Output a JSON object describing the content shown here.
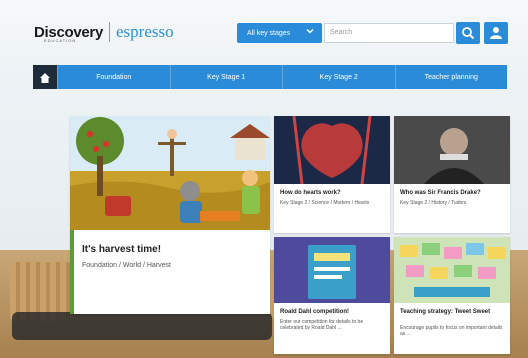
{
  "brand": {
    "name": "Discovery",
    "subtitle": "EDUCATION",
    "product": "espresso"
  },
  "header": {
    "stage_label": "All key stages",
    "search_placeholder": "Search"
  },
  "nav": {
    "items": [
      "Foundation",
      "Key Stage 1",
      "Key Stage 2",
      "Teacher planning"
    ]
  },
  "feature": {
    "title": "It's harvest time!",
    "meta": "Foundation / World / Harvest"
  },
  "cards": [
    {
      "title": "How do hearts work?",
      "meta": "Key Stage 2 / Science / Modern / Hearts"
    },
    {
      "title": "Who was Sir Francis Drake?",
      "meta": "Key Stage 2 / History / Tudors"
    },
    {
      "title": "Roald Dahl competition!",
      "meta": "Enter our competition for details to be celebrated by Roald Dahl ..."
    },
    {
      "title": "Teaching strategy: Tweet Sweet",
      "meta": "Encourage pupils to focus on important details as ..."
    }
  ],
  "colors": {
    "accent": "#2a8bd9",
    "nav_home": "#1e2b38",
    "product_text": "#2b8fd6"
  }
}
